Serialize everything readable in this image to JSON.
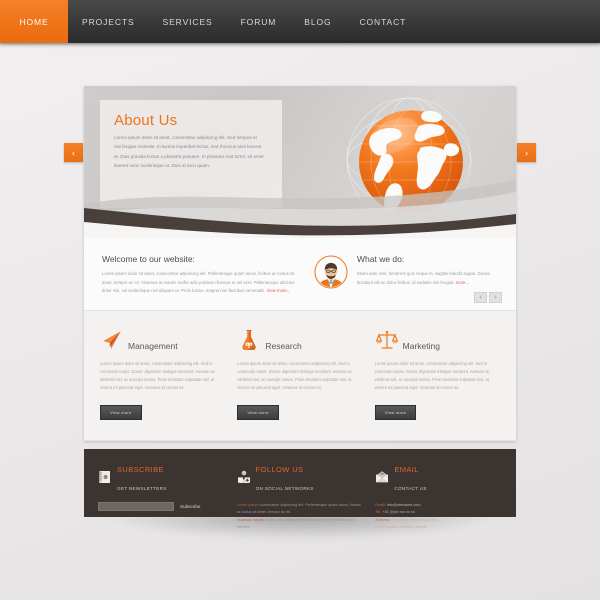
{
  "nav": {
    "items": [
      {
        "label": "HOME",
        "active": true
      },
      {
        "label": "PROJECTS",
        "active": false
      },
      {
        "label": "SERVICES",
        "active": false
      },
      {
        "label": "FORUM",
        "active": false
      },
      {
        "label": "BLOG",
        "active": false
      },
      {
        "label": "CONTACT",
        "active": false
      }
    ]
  },
  "colors": {
    "accent": "#ef7317",
    "nav_dark": "#3b3b3b",
    "footer_dark": "#3b3430",
    "link_red": "#e05a4e"
  },
  "hero": {
    "title": "About Us",
    "text": "Lorem ipsum dolor sit amet, consectetur adipiscing elit. Sed tempus et nisi feugiat molestie. In lacinia imperdiet lectus, sed rhoncus sem laoreet et. Duis gravida lectus a pharetra posuere. In pharetra erat tortor, sit amet laoreet nunc scelerisque ut. Duis at arcu quam.",
    "prev_label": "‹",
    "next_label": "›"
  },
  "welcome": {
    "heading": "Welcome to our website:",
    "text": "Lorem ipsum dolor sit amet, consectetur adipiscing elit. Pellentesque quam lacus, finibus ac luctus sit amet, tempor ac mi. Vivamus at mauris mollis odio pulvinar rhoncus et vel sem. Pellentesque ultricies dolor nisi, vel scelerisque nisl aliquam ut. Proin luctus, magna non faucibus venenatis.",
    "more_label": "View more..."
  },
  "whatwedo": {
    "heading": "What we do:",
    "text": "Etiam ante velit, hendrerit quis neque in, sagittis blandit augue. Donec tincidunt elit ac dolor finibus, id sodales nisl feugiat.",
    "more_label": "more...",
    "avatar_name": "bearded-man-avatar",
    "pager_prev": "‹",
    "pager_next": "›"
  },
  "services": [
    {
      "icon": "paper-plane-icon",
      "title": "Management",
      "text": "Lorem ipsum dolor sit amet, consectetur adipiscing elit. Sed in commodo turpis. Donec dignissim tristique tincidunt. Aenean ac eleifend nisl, ac suscipit metus. Proin tincidunt vulputate nisl, at viverra mi placerat eget. Vivamus id cursus mi.",
      "button": "View more"
    },
    {
      "icon": "flask-icon",
      "title": "Research",
      "text": "Lorem ipsum dolor sit amet, consectetur adipiscing elit. Sed in commodo turpis. Donec dignissim tristique tincidunt. Aenean ac eleifend nisl, ac suscipit metus. Proin tincidunt vulputate nisl, at viverra mi placerat eget. Vivamus id cursus mi.",
      "button": "View more"
    },
    {
      "icon": "scales-icon",
      "title": "Marketing",
      "text": "Lorem ipsum dolor sit amet, consectetur adipiscing elit. Sed in commodo turpis. Donec dignissim tristique tincidunt. Aenean ac eleifend nisl, ac suscipit metus. Proin tincidunt vulputate nisl, at viverra mi placerat eget. Vivamus id cursus mi.",
      "button": "View more"
    }
  ],
  "footer": {
    "subscribe": {
      "icon": "notebook-icon",
      "title": "SUBSCRIBE",
      "subtitle": "GET NEWSLETTERS",
      "input_placeholder": "",
      "input_value": "",
      "button": "Subscribe"
    },
    "follow": {
      "icon": "social-share-icon",
      "title": "FOLLOW US",
      "subtitle": "ON SOCIAL NETWORKS",
      "text_1_hl": "Lorem ipsum",
      "text_1": " consectetur adipiscing elit. Pellentesque quam lacus, finibus ac luctus sit amet, tempor ac mi.",
      "text_2_hl": "Vivamus mauris",
      "text_2": " mollis odio pulvinar rhoncus et vel sem. Pellentesque ultricies."
    },
    "email": {
      "icon": "envelope-icon",
      "title": "EMAIL",
      "subtitle": "CONTACT US",
      "lines": [
        {
          "label": "Email:",
          "value": "info@sitename.com"
        },
        {
          "label": "Tel:",
          "value": "+31 (0)xx xxx xx xx"
        },
        {
          "label": "Address:",
          "value": "Phasellus pellentesque litho,"
        },
        {
          "label": "",
          "value": "6000 Lobortis vehicula, Mauris"
        }
      ]
    }
  }
}
